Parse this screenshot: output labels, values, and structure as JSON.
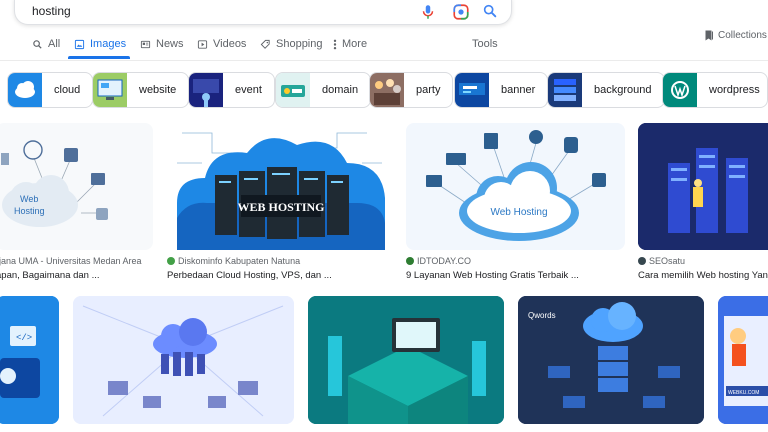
{
  "search": {
    "query": "hosting"
  },
  "tabs": [
    {
      "label": "All",
      "icon": "search-icon"
    },
    {
      "label": "Images",
      "icon": "image-icon",
      "active": true
    },
    {
      "label": "News",
      "icon": "news-icon"
    },
    {
      "label": "Videos",
      "icon": "video-icon"
    },
    {
      "label": "Shopping",
      "icon": "tag-icon"
    },
    {
      "label": "More",
      "icon": "more-vert-icon"
    }
  ],
  "tools_label": "Tools",
  "collections_label": "Collections",
  "chips": [
    "cloud",
    "website",
    "event",
    "domain",
    "party",
    "banner",
    "background",
    "wordpress"
  ],
  "results_row1": [
    {
      "source": "rjana UMA - Universitas Medan Area",
      "title": "apan, Bagaimana dan ..."
    },
    {
      "source": "Diskominfo Kabupaten Natuna",
      "title": "Perbedaan Cloud Hosting, VPS, dan ..."
    },
    {
      "source": "IDTODAY.CO",
      "title": "9 Layanan Web Hosting Gratis Terbaik ..."
    },
    {
      "source": "SEOsatu",
      "title": "Cara memilih Web hosting Yang t"
    }
  ],
  "image_text": {
    "web_hosting_cloud": "Web\nHosting",
    "web_hosting_banner": "WEB HOSTING",
    "web_hosting_cloud2": "Web Hosting",
    "qwords": "Qwords",
    "webku": "WEBKU.COM"
  },
  "colors": {
    "accent": "#1a73e8",
    "text": "#202124",
    "muted": "#5f6368",
    "border": "#dadce0"
  }
}
